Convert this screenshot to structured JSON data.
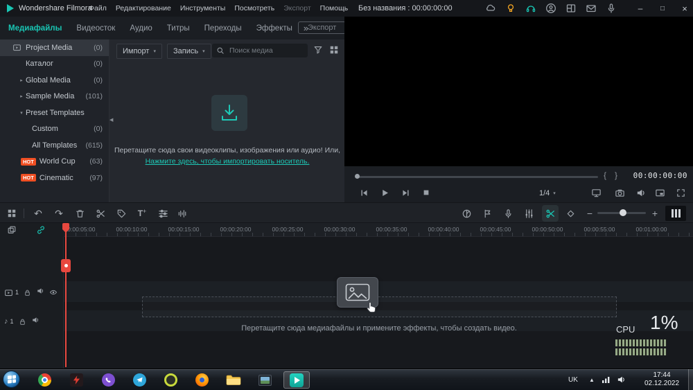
{
  "colors": {
    "accent_teal": "#19c5b3",
    "playhead_red": "#e8483f",
    "hot_orange": "#f04f23",
    "cpu_meter_green": "#96aa87"
  },
  "titlebar": {
    "app_name": "Wondershare Filmora",
    "menus": [
      "Файл",
      "Редактирование",
      "Инструменты",
      "Посмотреть",
      "Экспорт",
      "Помощь"
    ],
    "project_title": "Без названия : 00:00:00:00"
  },
  "tabs": {
    "items": [
      "Медиафайлы",
      "Видеосток",
      "Аудио",
      "Титры",
      "Переходы",
      "Эффекты"
    ],
    "active": "Медиафайлы",
    "export_label": "Экспорт"
  },
  "sidebar": {
    "items": [
      {
        "label": "Project Media",
        "count": "(0)"
      },
      {
        "label": "Каталог",
        "count": "(0)"
      },
      {
        "label": "Global Media",
        "count": "(0)"
      },
      {
        "label": "Sample Media",
        "count": "(101)"
      },
      {
        "label": "Preset Templates",
        "count": ""
      },
      {
        "label": "Custom",
        "count": "(0)"
      },
      {
        "label": "All Templates",
        "count": "(615)"
      },
      {
        "label": "World Cup",
        "count": "(63)",
        "badge": "HOT"
      },
      {
        "label": "Cinematic",
        "count": "(97)",
        "badge": "HOT"
      }
    ]
  },
  "media": {
    "import_label": "Импорт",
    "record_label": "Запись",
    "search_placeholder": "Поиск медиа",
    "drop_text": "Перетащите сюда свои видеоклипы, изображения или аудио! Или,",
    "drop_link": "Нажмите здесь, чтобы импортировать носитель."
  },
  "preview": {
    "timecode": "00:00:00:00",
    "quality_label": "1/4"
  },
  "toolbar": {
    "titles_label": "T"
  },
  "timeline": {
    "ruler": [
      "00:00:05:00",
      "00:00:10:00",
      "00:00:15:00",
      "00:00:20:00",
      "00:00:25:00",
      "00:00:30:00",
      "00:00:35:00",
      "00:00:40:00",
      "00:00:45:00",
      "00:00:50:00",
      "00:00:55:00",
      "00:01:00:00"
    ],
    "video_track_number": "1",
    "audio_track_number": "1",
    "drop_text": "Перетащите сюда медиафайлы и примените эффекты, чтобы создать видео."
  },
  "cpu": {
    "label": "CPU",
    "value": "1%"
  },
  "taskbar": {
    "language": "UK",
    "time": "17:44",
    "date": "02.12.2022"
  },
  "icons": {
    "chevron_more": "»",
    "caret_down": "▾",
    "tree_right": "▸",
    "tree_down": "▾",
    "collapse_left": "◀",
    "undo": "↶",
    "redo": "↷",
    "brace_open": "{",
    "brace_close": "}",
    "music_note": "♪",
    "minus": "−",
    "plus": "+",
    "minimize": "–",
    "maximize": "□",
    "close": "×",
    "tray_up": "▲"
  }
}
